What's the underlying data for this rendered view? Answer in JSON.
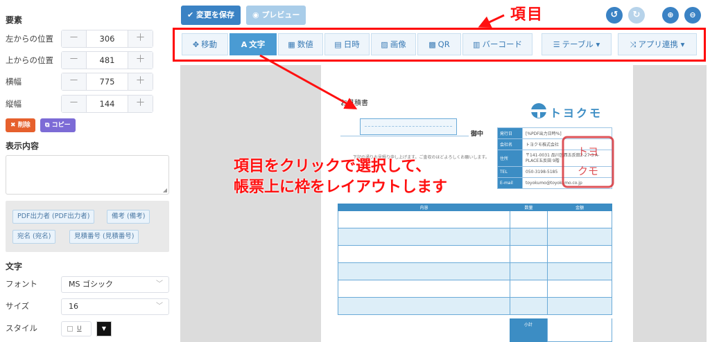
{
  "properties": {
    "section_title": "要素",
    "fields": [
      {
        "label": "左からの位置",
        "value": "306"
      },
      {
        "label": "上からの位置",
        "value": "481"
      },
      {
        "label": "横幅",
        "value": "775"
      },
      {
        "label": "縦幅",
        "value": "144"
      }
    ],
    "minus": "－",
    "plus": "＋",
    "delete_label": "削除",
    "copy_label": "コピー"
  },
  "content": {
    "section_title": "表示内容",
    "textarea_value": "",
    "tags": [
      "PDF出力者 (PDF出力者)",
      "備考 (備考)",
      "宛名 (宛名)",
      "見積番号 (見積番号)"
    ]
  },
  "text_settings": {
    "section_title": "文字",
    "font_label": "フォント",
    "font_value": "MS ゴシック",
    "size_label": "サイズ",
    "size_value": "16",
    "style_label": "スタイル",
    "underline_label": "U"
  },
  "toolbar": {
    "save_label": "変更を保存",
    "preview_label": "プレビュー"
  },
  "item_tabs": [
    {
      "icon": "move-icon",
      "glyph": "✥",
      "label": "移動",
      "active": false
    },
    {
      "icon": "text-icon",
      "glyph": "A",
      "label": "文字",
      "active": true
    },
    {
      "icon": "calculator-icon",
      "glyph": "▦",
      "label": "数値",
      "active": false
    },
    {
      "icon": "calendar-icon",
      "glyph": "▤",
      "label": "日時",
      "active": false
    },
    {
      "icon": "image-icon",
      "glyph": "▨",
      "label": "画像",
      "active": false
    },
    {
      "icon": "qr-icon",
      "glyph": "▩",
      "label": "QR",
      "active": false
    },
    {
      "icon": "barcode-icon",
      "glyph": "▥",
      "label": "バーコード",
      "active": false
    },
    {
      "icon": "list-icon",
      "glyph": "☰",
      "label": "テーブル",
      "active": false
    },
    {
      "icon": "shuffle-icon",
      "glyph": "⤨",
      "label": "アプリ連携",
      "active": false
    }
  ],
  "annotations": {
    "title": "項目",
    "note_line1": "項目をクリックで選択して、",
    "note_line2": "帳票上に枠をレイアウトします"
  },
  "document": {
    "title": "お見積書",
    "honorific": "御中",
    "message": "下記の通りお見積り申し上げます。ご査収のほどよろしくお願いします。",
    "logo_text": "トヨクモ",
    "info_rows": [
      {
        "key": "発行日",
        "value": "[%PDF出力日時%]"
      },
      {
        "key": "会社名",
        "value": "トヨクモ株式会社"
      },
      {
        "key": "住所",
        "value": "〒141-0031 品川区西五反田2-27-3 A-PLACE五反田 9階"
      },
      {
        "key": "TEL",
        "value": "050-3198-5185"
      },
      {
        "key": "E-mail",
        "value": "toyokumo@toyokumo.co.jp"
      }
    ],
    "seal_text": "トヨクモ",
    "table_headers": [
      "内容",
      "数量",
      "金額"
    ],
    "subtotal_label": "小計"
  },
  "colors": {
    "primary": "#3a82c4",
    "accent": "#4a9bd3",
    "annotation": "#ff1010",
    "delete": "#e6602d",
    "copy": "#7c6bd6"
  }
}
